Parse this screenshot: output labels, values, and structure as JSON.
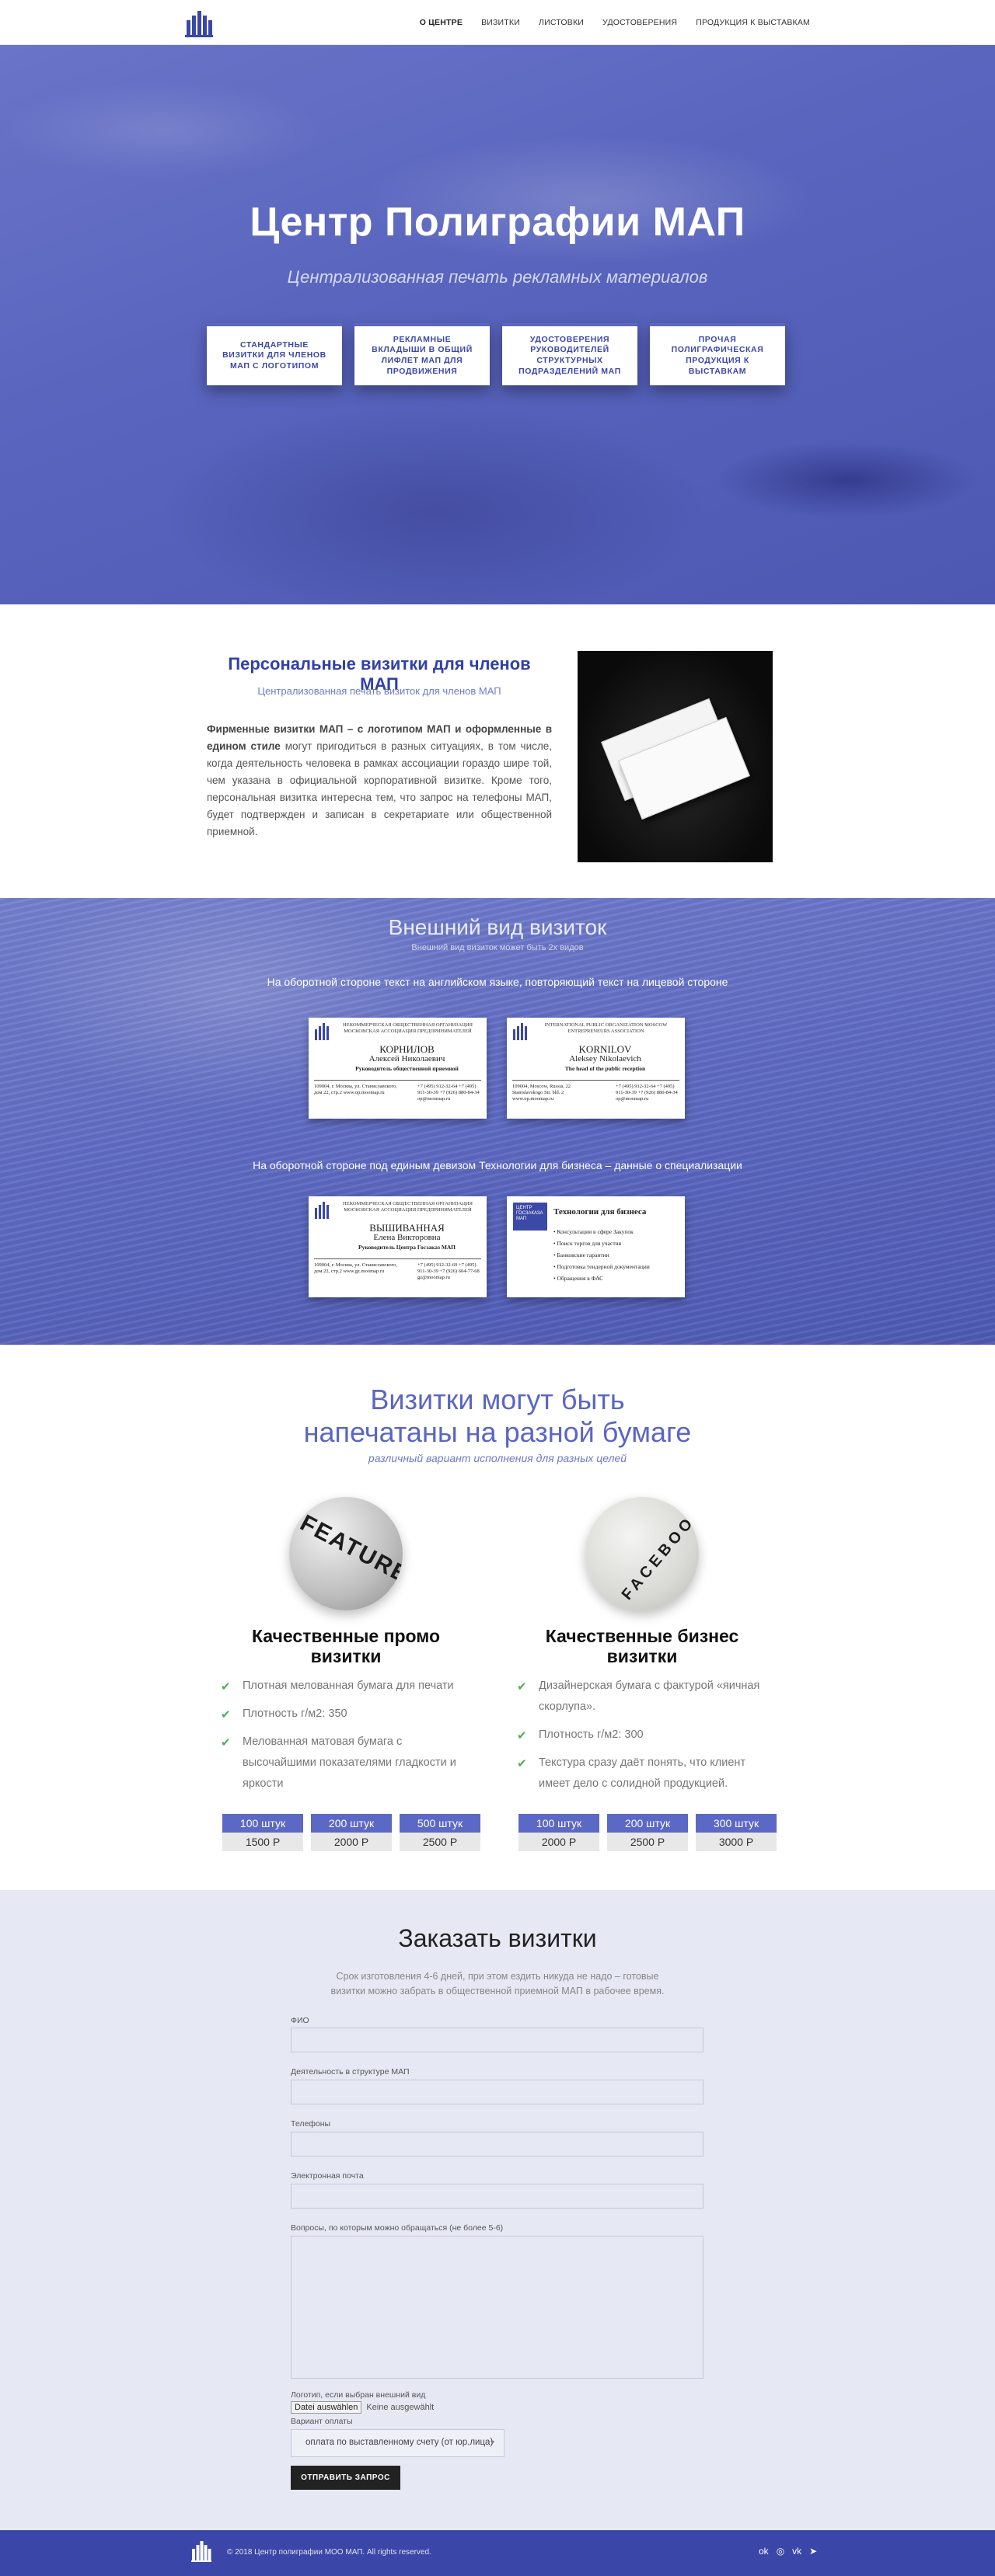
{
  "colors": {
    "accent": "#3a47a8",
    "hero": "#5864bd",
    "green": "#4caf50",
    "order_bg": "#e6e8f4"
  },
  "nav": {
    "items": [
      {
        "label": "О ЦЕНТРЕ",
        "active": true
      },
      {
        "label": "ВИЗИТКИ"
      },
      {
        "label": "ЛИСТОВКИ"
      },
      {
        "label": "УДОСТОВЕРЕНИЯ"
      },
      {
        "label": "ПРОДУКЦИЯ К ВЫСТАВКАМ"
      }
    ]
  },
  "hero": {
    "title": "Центр Полиграфии МАП",
    "subtitle": "Централизованная печать рекламных материалов",
    "buttons": [
      "СТАНДАРТНЫЕ ВИЗИТКИ ДЛЯ ЧЛЕНОВ МАП С ЛОГОТИПОМ",
      "РЕКЛАМНЫЕ ВКЛАДЫШИ В ОБЩИЙ ЛИФЛЕТ МАП ДЛЯ ПРОДВИЖЕНИЯ",
      "УДОСТОВЕРЕНИЯ РУКОВОДИТЕЛЕЙ СТРУКТУРНЫХ ПОДРАЗДЕЛЕНИЙ МАП",
      "ПРОЧАЯ ПОЛИГРАФИЧЕСКАЯ ПРОДУКЦИЯ К ВЫСТАВКАМ"
    ]
  },
  "personal": {
    "title": "Персональные визитки для членов МАП",
    "subtitle": "Централизованная печать визиток для членов МАП",
    "text_bold": "Фирменные визитки МАП – с логотипом МАП и оформленные в едином стиле",
    "text_rest": " могут пригодиться в разных ситуациях, в том числе, когда деятельность человека в рамках ассоциации гораздо шире той, чем указана в официальной корпоративной визитке. Кроме того, персональная визитка интересна тем, что запрос на телефоны МАП, будет подтвержден и записан в секретариате или общественной приемной."
  },
  "view": {
    "title": "Внешний вид визиток",
    "subtitle": "Внешний вид визиток может быть 2х видов",
    "caption1": "На оборотной стороне текст на английском языке, повторяющий текст на лицевой стороне",
    "caption2": "На оборотной стороне под единым девизом Технологии для бизнеса – данные о специализации",
    "card1": {
      "org": "НЕКОММЕРЧЕСКАЯ ОБЩЕСТВЕННАЯ ОРГАНИЗАЦИЯ МОСКОВСКАЯ АССОЦИАЦИЯ ПРЕДПРИНИМАТЕЛЕЙ",
      "name": "КОРНИЛОВ",
      "name2": "Алексей Николаевич",
      "role": "Руководитель общественной приемной",
      "addr": "109004, г. Москва, ул. Станиславского, дом 22, стр.2 www.op.moomap.ru",
      "phones": "+7 (495) 912-32-64 +7 (495) 911-30-39 +7 (926) 880-84-34 op@moomap.ru"
    },
    "card2": {
      "org": "INTERNATIONAL PUBLIC ORGANIZATION MOSCOW ENTREPRENEURS ASSOCIATION",
      "name": "KORNILOV",
      "name2": "Aleksey Nikolaevich",
      "role": "The head of the public reception",
      "addr": "109004, Moscow, Russia, 22 Stanislavskogo Str. bld. 2 www.op.moomap.ru",
      "phones": "+7 (495) 912-32-64 +7 (495) 911-30-39 +7 (926) 880-84-34 op@moomap.ru"
    },
    "card3": {
      "org": "НЕКОММЕРЧЕСКАЯ ОБЩЕСТВЕННАЯ ОРГАНИЗАЦИЯ МОСКОВСКАЯ АССОЦИАЦИЯ ПРЕДПРИНИМАТЕЛЕЙ",
      "name": "ВЫШИВАННАЯ",
      "name2": "Елена Викторовна",
      "role": "Руководитель Центра Госзаказ МАП",
      "addr": "109004, г. Москва, ул. Станиславского, дом 22, стр.2 www.gz.moomap.ru",
      "phones": "+7 (495) 912-32-69 +7 (495) 911-30-39 +7 (926) 604-77-68 gz@moomap.ru"
    },
    "card4": {
      "logo": "ЦЕНТР ГОСЗАКАЗА МАП",
      "title": "Технологии для бизнеса",
      "items": [
        "• Консультации в сфере Закупок",
        "• Поиск торгов для участия",
        "• Банковские гарантии",
        "• Подготовка тендерной документации",
        "• Обращения в ФАС"
      ]
    }
  },
  "paper": {
    "title_line1": "Визитки могут быть",
    "title_line2": "напечатаны на разной бумаге",
    "subtitle": "различный вариант исполнения для разных целей",
    "columns": [
      {
        "image_text": "FEATURES",
        "title": "Качественные промо визитки",
        "features": [
          "Плотная мелованная бумага для печати",
          "Плотность г/м2: 350",
          "Мелованная матовая бумага с высочайшими показателями гладкости и яркости"
        ],
        "prices": [
          {
            "qty": "100 штук",
            "price": "1500 Р"
          },
          {
            "qty": "200 штук",
            "price": "2000 Р"
          },
          {
            "qty": "500 штук",
            "price": "2500 Р"
          }
        ]
      },
      {
        "image_text": "FACEBOOK",
        "title": "Качественные бизнес визитки",
        "features": [
          "Дизайнерская бумага с фактурой «яичная скорлупа».",
          "Плотность г/м2: 300",
          "Текстура сразу даёт понять, что клиент имеет дело с солидной продукцией."
        ],
        "prices": [
          {
            "qty": "100 штук",
            "price": "2000 Р"
          },
          {
            "qty": "200 штук",
            "price": "2500 Р"
          },
          {
            "qty": "300 штук",
            "price": "3000 Р"
          }
        ]
      }
    ]
  },
  "order": {
    "title": "Заказать визитки",
    "subtitle": "Срок изготовления 4-6 дней, при этом ездить никуда не надо – готовые визитки можно забрать в общественной приемной МАП в рабочее время.",
    "fields": {
      "fio": "ФИО",
      "activity": "Деятельность в структуре МАП",
      "phones": "Телефоны",
      "email": "Электронная почта",
      "questions": "Вопросы, по которым можно обращаться (не более 5-6)"
    },
    "logo_label": "Логотип, если выбран внешний вид",
    "file_button": "Datei auswählen",
    "file_status": "Keine ausgewählt",
    "payment_label": "Вариант оплаты",
    "payment_value": "оплата по выставленному счету (от юр.лица)",
    "submit": "ОТПРАВИТЬ ЗАПРОС"
  },
  "footer": {
    "copyright": "© 2018 Центр полиграфии МОО МАП. All rights reserved.",
    "social": [
      "odnoklassniki-icon",
      "instagram-icon",
      "vk-icon",
      "telegram-icon"
    ]
  }
}
